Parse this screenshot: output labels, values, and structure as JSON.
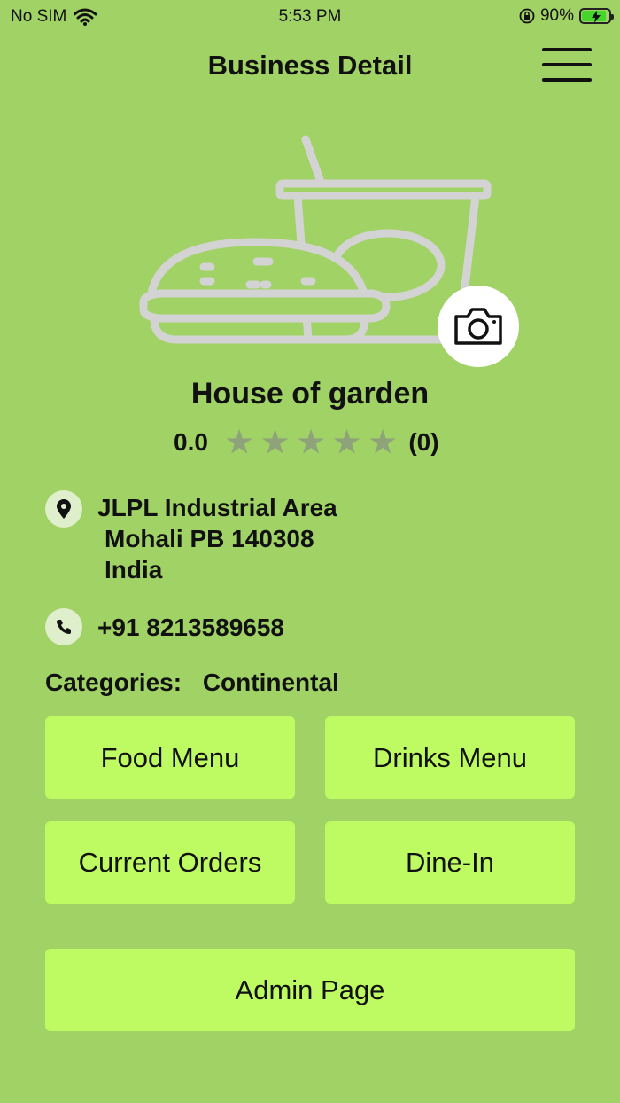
{
  "status_bar": {
    "carrier": "No SIM",
    "time": "5:53 PM",
    "battery": "90%",
    "battery_level": 0.9
  },
  "nav": {
    "title": "Business Detail",
    "menu_icon": "hamburger-menu-icon"
  },
  "hero": {
    "image_icon": "burger-and-drink-icon",
    "camera_icon": "camera-icon"
  },
  "business": {
    "name": "House of garden",
    "rating": "0.0",
    "stars_filled": 0,
    "stars_total": 5,
    "review_count": "(0)",
    "address_line1": "JLPL Industrial Area",
    "address_line2": "Mohali PB 140308",
    "address_line3": "India",
    "phone": "+91 8213589658",
    "categories_label": "Categories:",
    "categories_value": "Continental"
  },
  "buttons": {
    "food_menu": "Food Menu",
    "drinks_menu": "Drinks Menu",
    "current_orders": "Current Orders",
    "dine_in": "Dine-In",
    "admin_page": "Admin Page"
  },
  "colors": {
    "background": "#a1d265",
    "button": "#befa61",
    "icon_bg": "#dfeecb",
    "star_empty": "#8fa37b"
  }
}
